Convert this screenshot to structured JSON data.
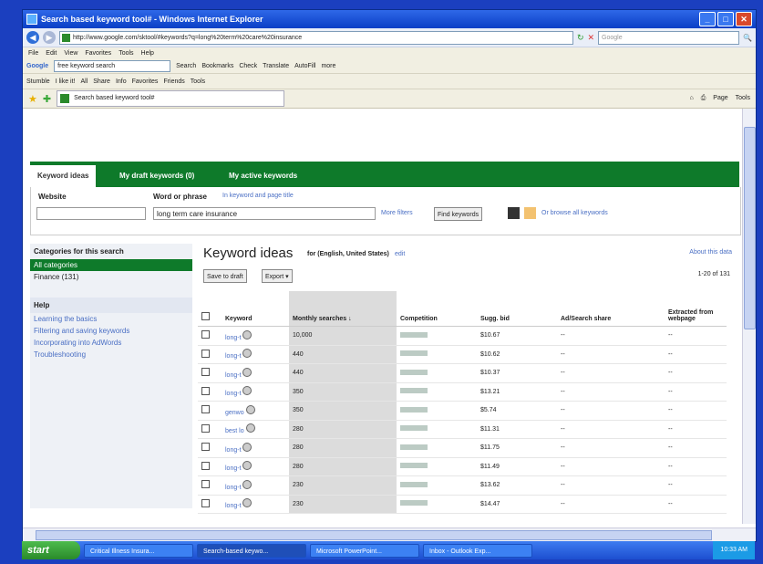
{
  "window": {
    "title": "Search based keyword tool# - Windows Internet Explorer"
  },
  "address": {
    "url": "http://www.google.com/sktool/#keywords?q=long%20term%20care%20insurance",
    "search_placeholder": "Google"
  },
  "menu": [
    "File",
    "Edit",
    "View",
    "Favorites",
    "Tools",
    "Help"
  ],
  "toolbar1": {
    "google": "Google",
    "query": "free keyword search",
    "items": [
      "Search",
      "Bookmarks",
      "Check",
      "Translate",
      "AutoFill",
      "more"
    ]
  },
  "toolbar2": {
    "items": [
      "Stumble",
      "I like it!",
      "All",
      "Share",
      "Info",
      "Favorites",
      "Friends",
      "Tools"
    ]
  },
  "tabs": {
    "page_tab": "Search based keyword tool#",
    "commands": [
      "Page",
      "Tools"
    ]
  },
  "keyword_tabs": [
    "Keyword ideas",
    "My draft keywords (0)",
    "My active keywords"
  ],
  "filter": {
    "website_label": "Website",
    "phrase_label": "Word or phrase",
    "phrase_hint": "In keyword and page title",
    "phrase_value": "long term care insurance",
    "more_filters": "More filters",
    "find_button": "Find keywords",
    "browse": "Or browse all keywords"
  },
  "left": {
    "categories_title": "Categories for this search",
    "categories": [
      "All categories",
      "Finance (131)"
    ],
    "help_title": "Help",
    "help_links": [
      "Learning the basics",
      "Filtering and saving keywords",
      "Incorporating into AdWords",
      "Troubleshooting"
    ]
  },
  "main": {
    "title": "Keyword ideas",
    "locale": "for (English, United States)",
    "edit": "edit",
    "about": "About this data",
    "save_btn": "Save to draft",
    "export_btn": "Export",
    "pager": "1-20 of 131"
  },
  "table": {
    "headers": [
      "Keyword",
      "Monthly searches",
      "Competition",
      "Sugg. bid",
      "Ad/Search share",
      "Extracted from webpage"
    ],
    "rows": [
      {
        "kw": "long-t",
        "searches": "10,000",
        "bid": "$10.67"
      },
      {
        "kw": "long-t",
        "searches": "440",
        "bid": "$10.62"
      },
      {
        "kw": "long-t",
        "searches": "440",
        "bid": "$10.37"
      },
      {
        "kw": "long-t",
        "searches": "350",
        "bid": "$13.21"
      },
      {
        "kw": "genwo",
        "searches": "350",
        "bid": "$5.74"
      },
      {
        "kw": "best lo",
        "searches": "280",
        "bid": "$11.31"
      },
      {
        "kw": "long-t",
        "searches": "280",
        "bid": "$11.75"
      },
      {
        "kw": "long-t",
        "searches": "280",
        "bid": "$11.49"
      },
      {
        "kw": "long-t",
        "searches": "230",
        "bid": "$13.62"
      },
      {
        "kw": "long-t",
        "searches": "230",
        "bid": "$14.47"
      }
    ],
    "dash": "--"
  },
  "taskbar": {
    "start": "start",
    "tasks": [
      "Critical Illness Insura...",
      "Search-based keywo...",
      "Microsoft PowerPoint...",
      "Inbox - Outlook Exp..."
    ],
    "clock": "10:33 AM"
  }
}
